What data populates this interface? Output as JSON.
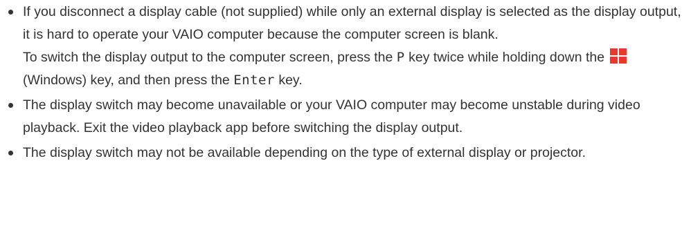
{
  "notes": [
    {
      "para1": "If you disconnect a display cable (not supplied) while only an external display is selected as the display output, it is hard to operate your VAIO computer because the computer screen is blank.",
      "para2_a": "To switch the display output to the computer screen, press the ",
      "key_p": "P",
      "para2_b": " key twice while holding down the ",
      "para2_c": " (Windows) key, and then press the ",
      "key_enter": "Enter",
      "para2_d": " key."
    },
    {
      "text": "The display switch may become unavailable or your VAIO computer may become unstable during video playback. Exit the video playback app before switching the display output."
    },
    {
      "text": "The display switch may not be available depending on the type of external display or projector."
    }
  ],
  "icons": {
    "windows_key": "windows-logo-icon"
  },
  "colors": {
    "text": "#333333",
    "windows_logo": "#e8392c"
  }
}
